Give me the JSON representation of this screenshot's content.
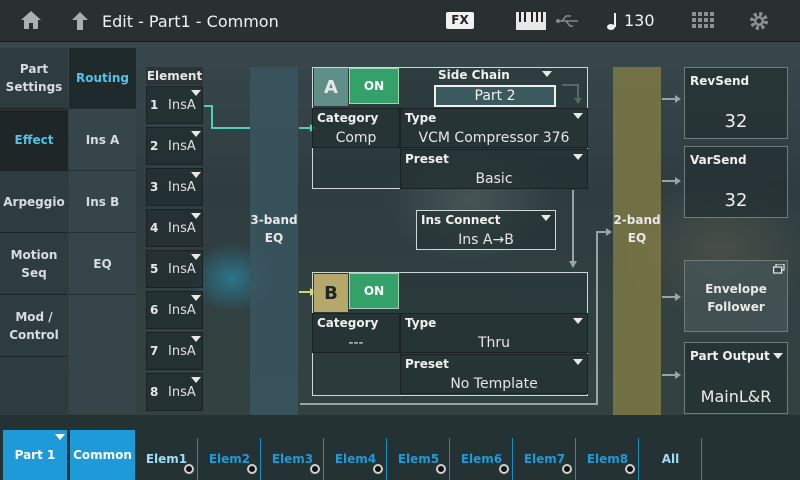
{
  "header": {
    "title": "Edit - Part1 - Common",
    "fx_badge": "FX",
    "tempo": "130",
    "icons": [
      "home-icon",
      "back-arrow-icon",
      "keyboard-icon",
      "usb-icon",
      "note-icon",
      "grid-icon",
      "gear-icon"
    ]
  },
  "left_tabs": [
    {
      "label1": "Part",
      "label2": "Settings"
    },
    {
      "label1": "Effect",
      "label2": ""
    },
    {
      "label1": "Arpeggio",
      "label2": ""
    },
    {
      "label1": "Motion",
      "label2": "Seq"
    },
    {
      "label1": "Mod /",
      "label2": "Control"
    }
  ],
  "sub_tabs": [
    "Routing",
    "Ins A",
    "Ins B",
    "EQ"
  ],
  "element": {
    "header": "Element",
    "rows": [
      {
        "num": "1",
        "value": "InsA"
      },
      {
        "num": "2",
        "value": "InsA"
      },
      {
        "num": "3",
        "value": "InsA"
      },
      {
        "num": "4",
        "value": "InsA"
      },
      {
        "num": "5",
        "value": "InsA"
      },
      {
        "num": "6",
        "value": "InsA"
      },
      {
        "num": "7",
        "value": "InsA"
      },
      {
        "num": "8",
        "value": "InsA"
      }
    ]
  },
  "eq3": {
    "line1": "3-band",
    "line2": "EQ"
  },
  "eq2": {
    "line1": "2-band",
    "line2": "EQ"
  },
  "insA": {
    "letter": "A",
    "on_label": "ON",
    "side_chain_label": "Side Chain",
    "side_chain_value": "Part 2",
    "category_label": "Category",
    "category_value": "Comp",
    "type_label": "Type",
    "type_value": "VCM Compressor 376",
    "preset_label": "Preset",
    "preset_value": "Basic"
  },
  "ins_connect": {
    "label": "Ins Connect",
    "value": "Ins A→B"
  },
  "insB": {
    "letter": "B",
    "on_label": "ON",
    "category_label": "Category",
    "category_value": "---",
    "type_label": "Type",
    "type_value": "Thru",
    "preset_label": "Preset",
    "preset_value": "No Template"
  },
  "right": {
    "rev_send": {
      "label": "RevSend",
      "value": "32"
    },
    "var_send": {
      "label": "VarSend",
      "value": "32"
    },
    "env_follower": {
      "line1": "Envelope",
      "line2": "Follower"
    },
    "part_output": {
      "label": "Part Output",
      "value": "MainL&R"
    }
  },
  "bottom": {
    "part": "Part 1",
    "common": "Common",
    "elements": [
      "Elem1",
      "Elem2",
      "Elem3",
      "Elem4",
      "Elem5",
      "Elem6",
      "Elem7",
      "Elem8"
    ],
    "all": "All"
  },
  "colors": {
    "accent": "#1f9ad8",
    "on": "#34a06a",
    "active_text": "#4fc3e8",
    "wire_teal": "#4fd1b8"
  }
}
